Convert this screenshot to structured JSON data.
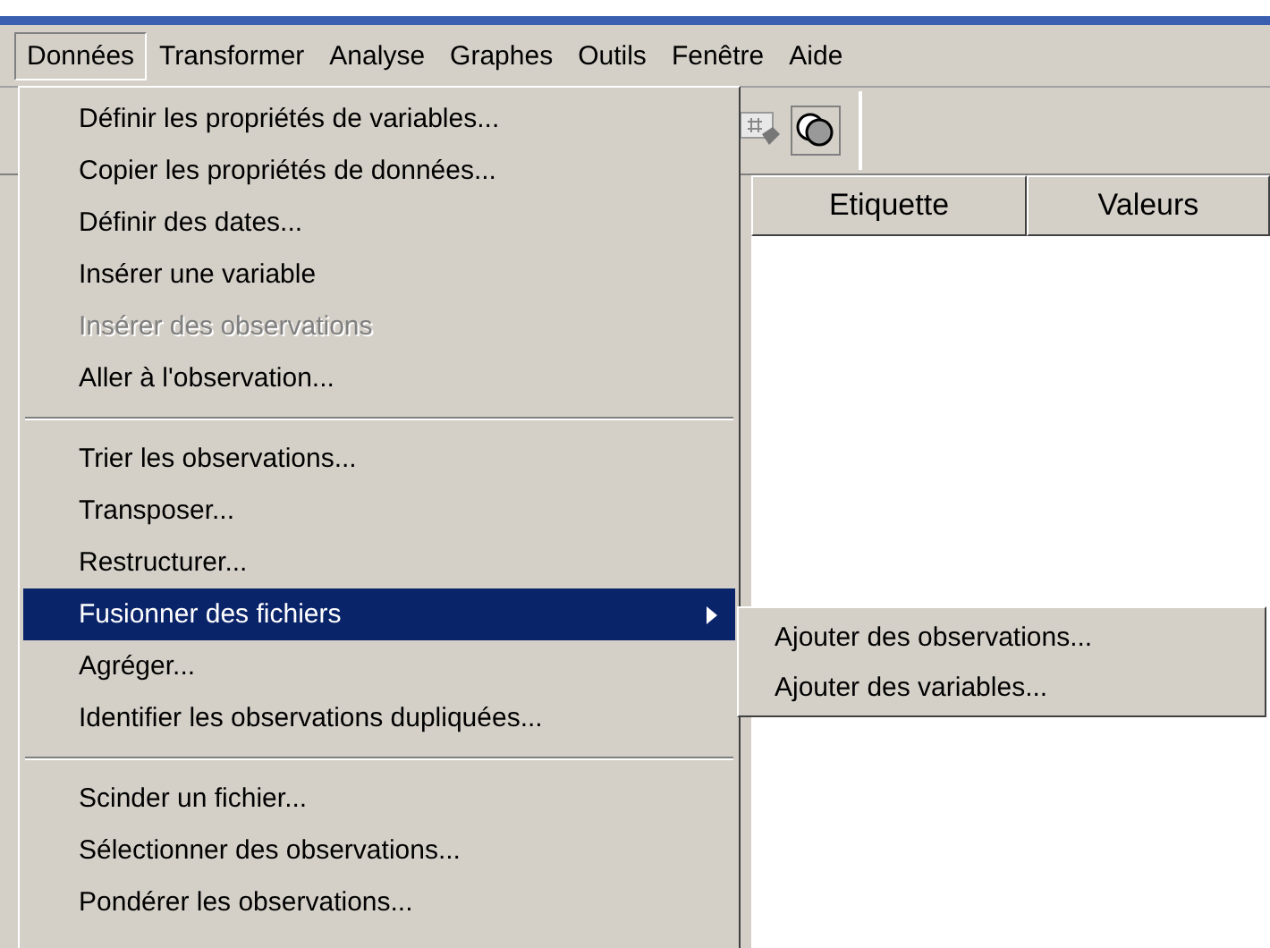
{
  "menubar": [
    {
      "label": "Données",
      "selected": true
    },
    {
      "label": "Transformer",
      "selected": false
    },
    {
      "label": "Analyse",
      "selected": false
    },
    {
      "label": "Graphes",
      "selected": false
    },
    {
      "label": "Outils",
      "selected": false
    },
    {
      "label": "Fenêtre",
      "selected": false
    },
    {
      "label": "Aide",
      "selected": false
    }
  ],
  "table": {
    "columns": [
      "Etiquette",
      "Valeurs"
    ]
  },
  "menu": [
    {
      "kind": "item",
      "label": "Définir les propriétés de variables...",
      "disabled": false,
      "selected": false,
      "submenu": false
    },
    {
      "kind": "item",
      "label": "Copier les propriétés de données...",
      "disabled": false,
      "selected": false,
      "submenu": false
    },
    {
      "kind": "item",
      "label": "Définir des dates...",
      "disabled": false,
      "selected": false,
      "submenu": false
    },
    {
      "kind": "item",
      "label": "Insérer une variable",
      "disabled": false,
      "selected": false,
      "submenu": false
    },
    {
      "kind": "item",
      "label": "Insérer des observations",
      "disabled": true,
      "selected": false,
      "submenu": false
    },
    {
      "kind": "item",
      "label": "Aller à l'observation...",
      "disabled": false,
      "selected": false,
      "submenu": false
    },
    {
      "kind": "separator"
    },
    {
      "kind": "item",
      "label": "Trier les observations...",
      "disabled": false,
      "selected": false,
      "submenu": false
    },
    {
      "kind": "item",
      "label": "Transposer...",
      "disabled": false,
      "selected": false,
      "submenu": false
    },
    {
      "kind": "item",
      "label": "Restructurer...",
      "disabled": false,
      "selected": false,
      "submenu": false
    },
    {
      "kind": "item",
      "label": "Fusionner des fichiers",
      "disabled": false,
      "selected": true,
      "submenu": true
    },
    {
      "kind": "item",
      "label": "Agréger...",
      "disabled": false,
      "selected": false,
      "submenu": false
    },
    {
      "kind": "item",
      "label": "Identifier les observations dupliquées...",
      "disabled": false,
      "selected": false,
      "submenu": false
    },
    {
      "kind": "separator"
    },
    {
      "kind": "item",
      "label": "Scinder un fichier...",
      "disabled": false,
      "selected": false,
      "submenu": false
    },
    {
      "kind": "item",
      "label": "Sélectionner des observations...",
      "disabled": false,
      "selected": false,
      "submenu": false
    },
    {
      "kind": "item",
      "label": "Pondérer les observations...",
      "disabled": false,
      "selected": false,
      "submenu": false
    }
  ],
  "submenu": [
    {
      "label": "Ajouter des observations..."
    },
    {
      "label": "Ajouter des variables..."
    }
  ]
}
